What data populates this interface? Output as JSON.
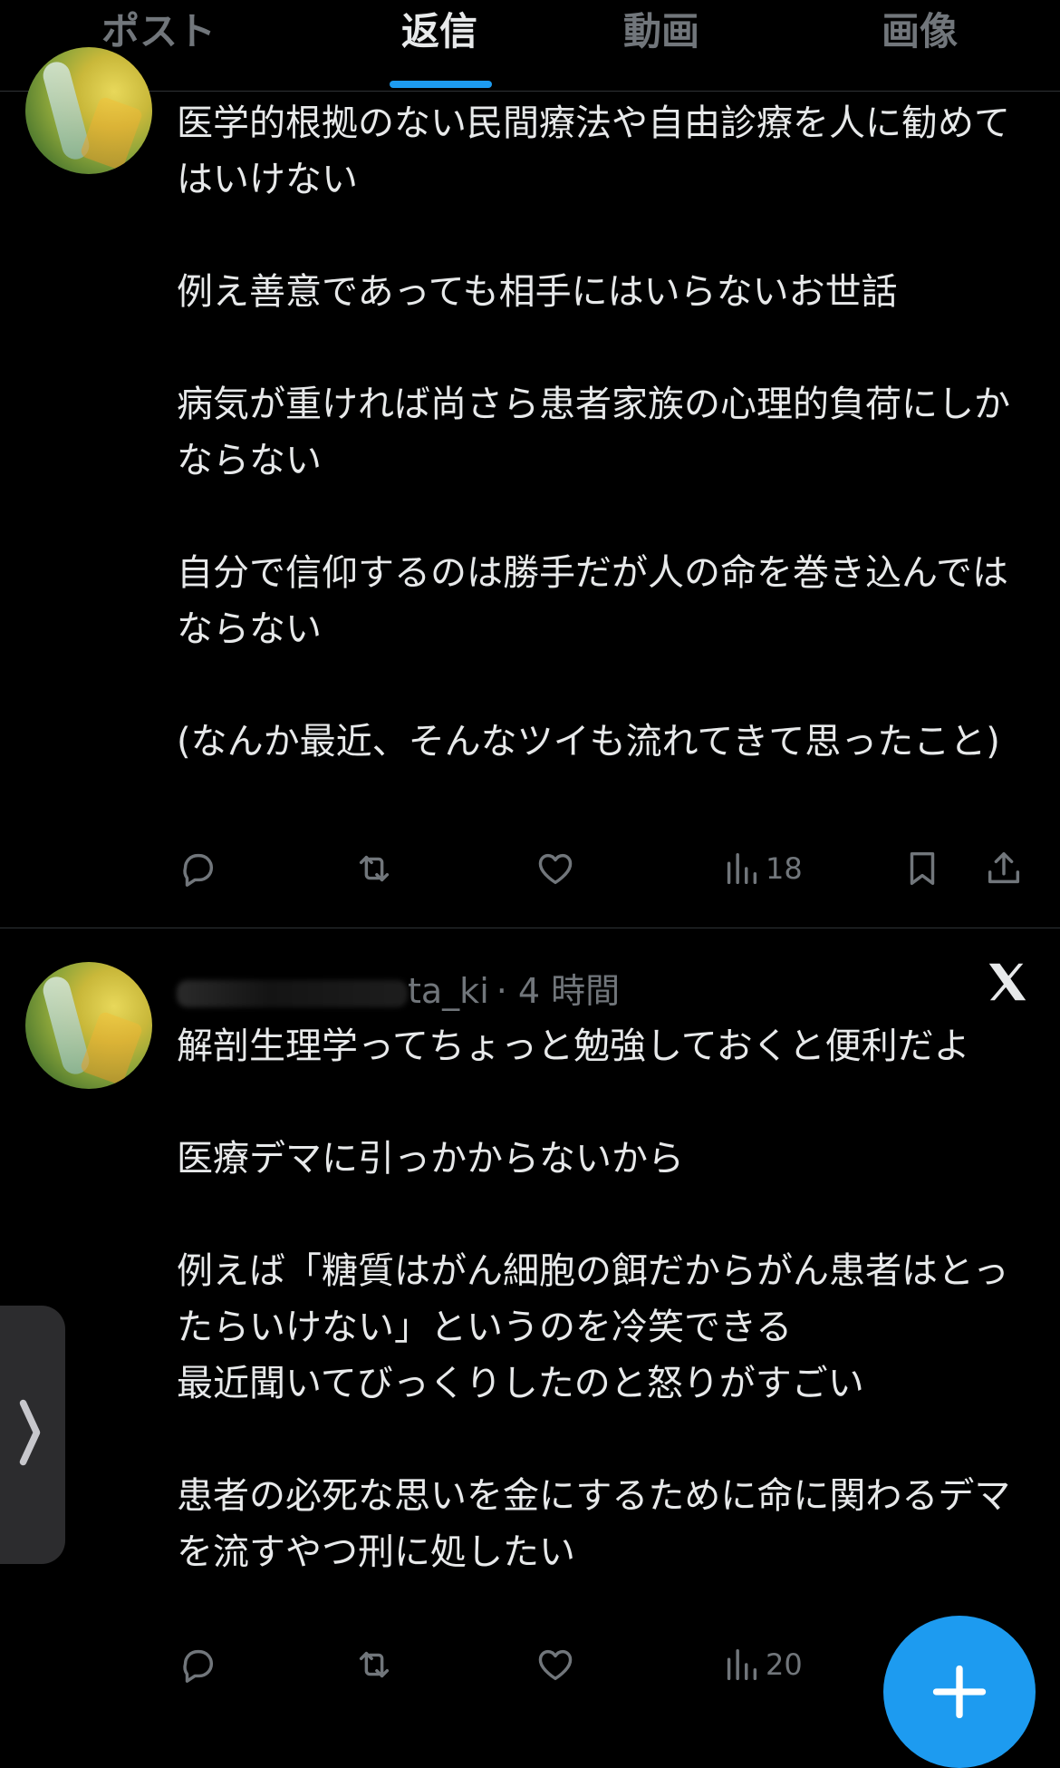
{
  "tabs": [
    {
      "label": "ポスト",
      "active": false
    },
    {
      "label": "返信",
      "active": true
    },
    {
      "label": "動画",
      "active": false
    },
    {
      "label": "画像",
      "active": false
    }
  ],
  "posts": [
    {
      "paragraphs": [
        "医学的根拠のない民間療法や自由診療を人に勧めてはいけない",
        "例え善意であっても相手にはいらないお世話",
        "病気が重ければ尚さら患者家族の心理的負荷にしかならない",
        "自分で信仰するのは勝手だが人の命を巻き込んではならない",
        "(なんか最近、そんなツイも流れてきて思ったこと)"
      ],
      "views": "18"
    },
    {
      "handle_visible": "ta_ki",
      "time": "· 4 時間",
      "paragraphs": [
        "解剖生理学ってちょっと勉強しておくと便利だよ",
        "医療デマに引っかからないから",
        "例えば「糖質はがん細胞の餌だからがん患者はとったらいけない」というのを冷笑できる\n最近聞いてびっくりしたのと怒りがすごい",
        "患者の必死な思いを金にするために命に関わるデマを流すやつ刑に処したい"
      ],
      "views": "20"
    }
  ],
  "icons": {
    "reply": "reply-icon",
    "repost": "repost-icon",
    "like": "heart-icon",
    "views": "views-icon",
    "bookmark": "bookmark-icon",
    "share": "share-icon",
    "x_logo": "x-logo-icon",
    "compose": "plus-icon",
    "side_handle": "chevron-right-icon"
  },
  "colors": {
    "background": "#000000",
    "text": "#e7e9ea",
    "muted": "#71767b",
    "accent": "#1d9bf0"
  }
}
